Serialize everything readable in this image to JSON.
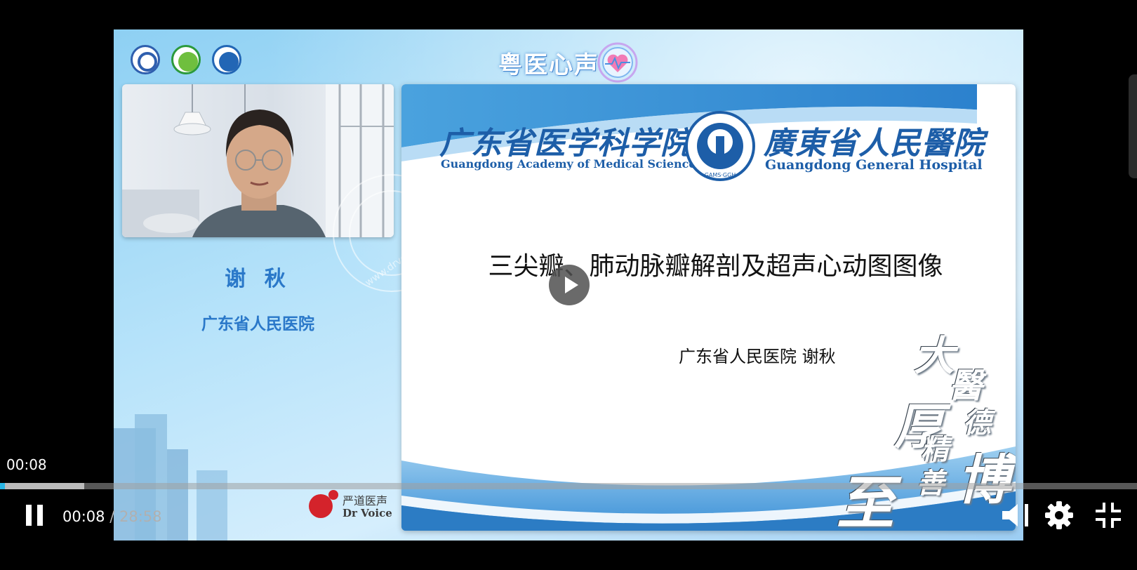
{
  "video": {
    "brand_title": "粤医心声",
    "speaker": {
      "name": "谢 秋",
      "organization": "广东省人民医院"
    },
    "watermark_text": "www.drvoice.cn",
    "sponsor": {
      "cn": "严道医声",
      "en": "Dr Voice"
    },
    "slide": {
      "header_left_cn": "广东省医学科学院",
      "header_left_en": "Guangdong Academy of Medical Sciences",
      "header_right_cn": "廣東省人民醫院",
      "header_right_en": "Guangdong General Hospital",
      "emblem_text": "GAMS·GGH",
      "title": "三尖瓣、肺动脉瓣解剖及超声心动图图像",
      "presenter": "广东省人民医院  谢秋",
      "calligraphy": [
        "大",
        "醫",
        "德",
        "厚",
        "精",
        "善",
        "至",
        "博"
      ]
    }
  },
  "player": {
    "hover_time": "00:08",
    "current_time": "00:08",
    "separator": "/",
    "duration": "28:58",
    "played_fraction": 0.0046,
    "buffered_fraction": 0.074,
    "accent_color": "#2ab7e6",
    "icons": [
      "play-icon",
      "pause-icon",
      "volume-icon",
      "settings-gear-icon",
      "exit-fullscreen-icon"
    ]
  }
}
